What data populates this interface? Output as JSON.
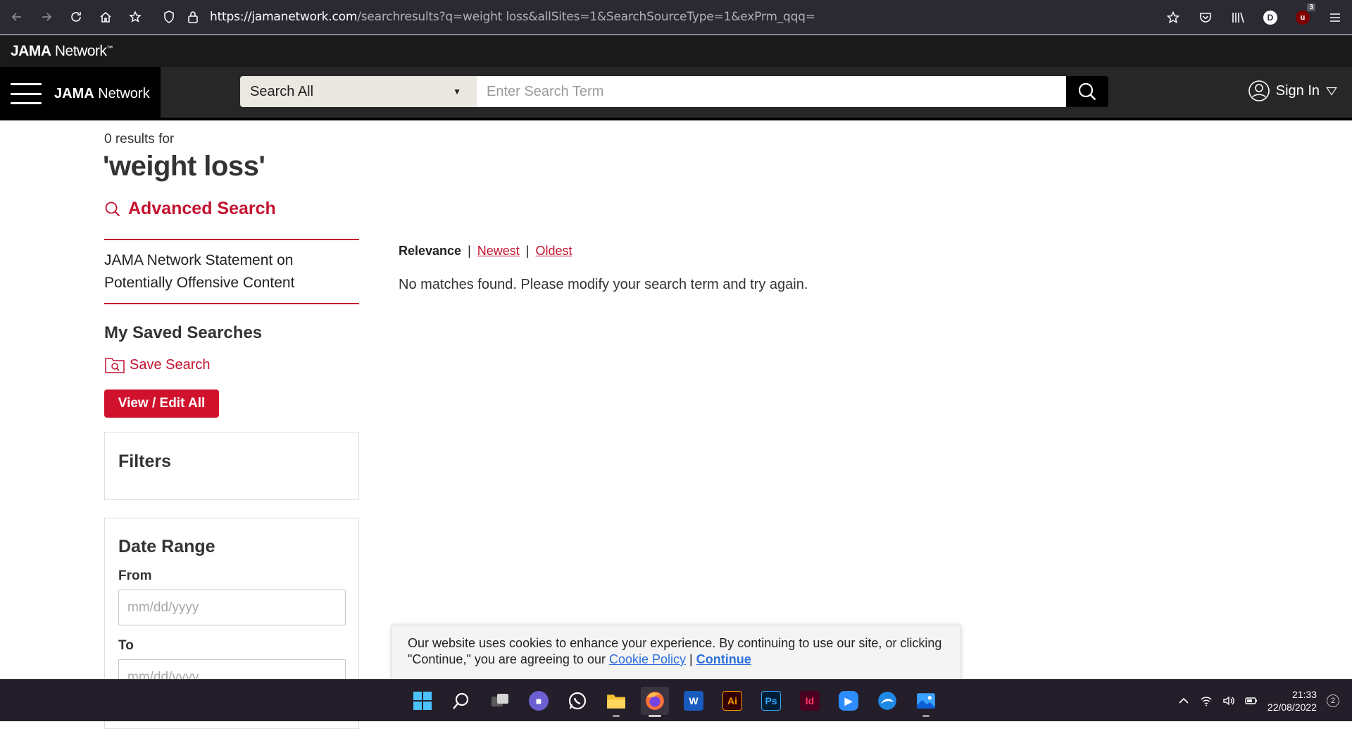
{
  "browser": {
    "url_host": "https://jamanetwork.com",
    "url_path": "/searchresults?q=weight loss&allSites=1&SearchSourceType=1&exPrm_qqq=",
    "profile_initial": "D",
    "extension_badge_letter": "u",
    "extension_count": "3"
  },
  "network_strip": {
    "logo_bold": "JAMA",
    "logo_rest": " Network",
    "logo_tm": "™"
  },
  "header": {
    "brand_bold": "JAMA",
    "brand_rest": " Network",
    "search_scope": "Search All",
    "search_placeholder": "Enter Search Term",
    "sign_in_label": "Sign In"
  },
  "results": {
    "count_text": "0 results for",
    "query": "'weight loss'",
    "advanced_search_label": "Advanced Search",
    "statement_link": "JAMA Network Statement on Potentially Offensive Content",
    "saved_searches_title": "My Saved Searches",
    "save_search_label": "Save Search",
    "view_edit_label": "View / Edit All",
    "filters_title": "Filters",
    "date_range_title": "Date Range",
    "from_label": "From",
    "from_placeholder": "mm/dd/yyyy",
    "to_label": "To",
    "to_placeholder": "mm/dd/yyyy"
  },
  "sort": {
    "active": "Relevance",
    "separator": "|",
    "newest": "Newest",
    "oldest": "Oldest"
  },
  "no_matches": "No matches found. Please modify your search term and try again.",
  "cookie": {
    "text": "Our website uses cookies to enhance your experience. By continuing to use our site, or clicking \"Continue,\" you are agreeing to our",
    "policy_link": "Cookie Policy",
    "separator": "|",
    "continue_link": "Continue"
  },
  "taskbar": {
    "apps": [
      "start",
      "search",
      "task-view",
      "teams",
      "whatsapp",
      "file-explorer",
      "firefox",
      "word",
      "illustrator",
      "photoshop",
      "indesign",
      "zoom",
      "edge-dev",
      "photos"
    ],
    "word_label": "W",
    "ai_label": "Ai",
    "ps_label": "Ps",
    "id_label": "Id",
    "time": "21:33",
    "date": "22/08/2022",
    "notifications": "2"
  },
  "colors": {
    "brand_red": "#c41230",
    "button_red": "#d0122d",
    "header_dark": "#272727",
    "browser_chrome": "#2b2a33"
  }
}
